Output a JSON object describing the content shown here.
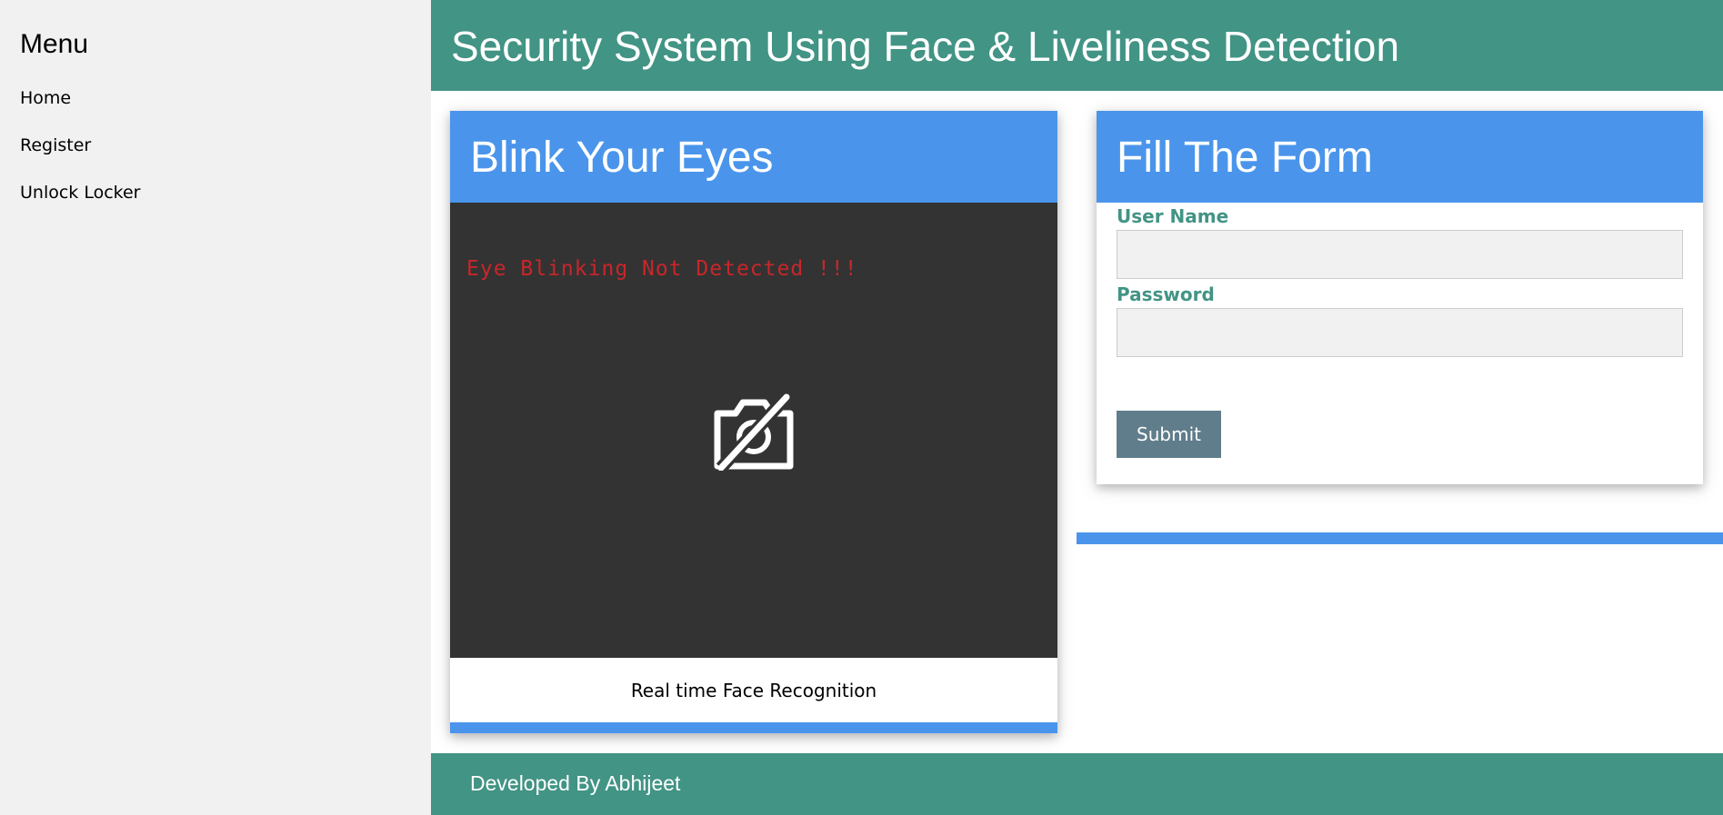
{
  "sidebar": {
    "title": "Menu",
    "items": [
      {
        "label": "Home"
      },
      {
        "label": "Register"
      },
      {
        "label": "Unlock Locker"
      }
    ]
  },
  "header": {
    "title": "Security System Using Face & Liveliness Detection",
    "background": "#429485"
  },
  "blink_card": {
    "title": "Blink Your Eyes",
    "status_text": "Eye Blinking Not Detected !!!",
    "status_color": "#c8262a",
    "camera_icon": "camera-off-icon",
    "caption": "Real time Face Recognition",
    "accent": "#4a95eb"
  },
  "form_card": {
    "title": "Fill The Form",
    "username_label": "User Name",
    "username_value": "",
    "password_label": "Password",
    "password_value": "",
    "submit_label": "Submit",
    "label_color": "#429485",
    "button_color": "#607d8b"
  },
  "footer": {
    "credit": "Developed By Abhijeet"
  }
}
